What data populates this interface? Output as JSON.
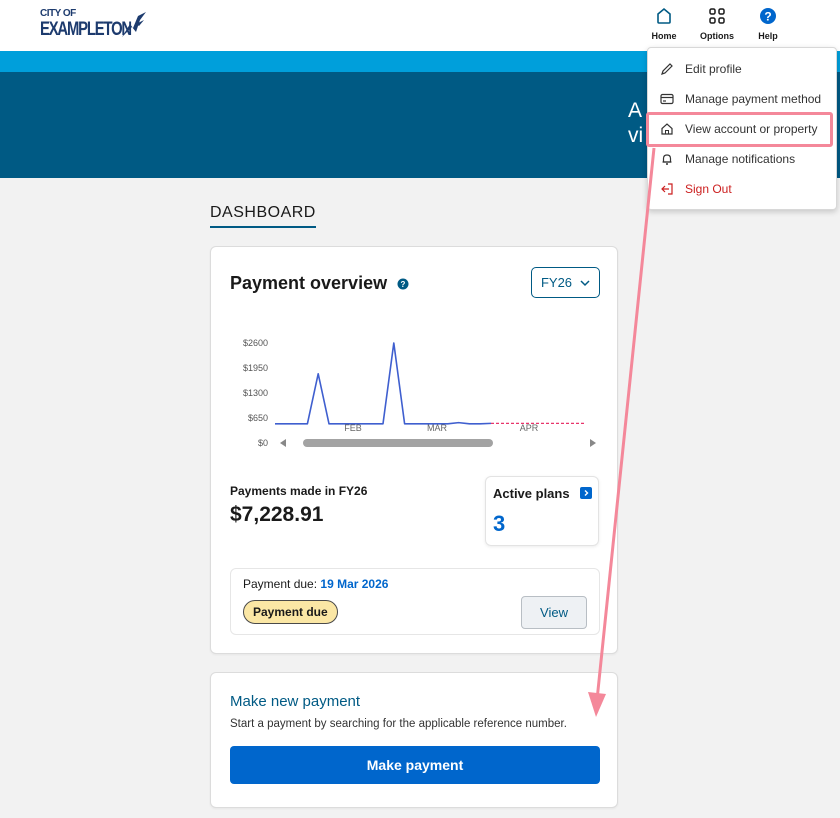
{
  "header": {
    "logo": {
      "line1": "CITY OF",
      "line2": "EXAMPLETON"
    },
    "nav": [
      {
        "id": "home",
        "label": "Home",
        "icon": "home-icon"
      },
      {
        "id": "options",
        "label": "Options",
        "icon": "grid-icon"
      },
      {
        "id": "help",
        "label": "Help",
        "icon": "question-icon"
      }
    ]
  },
  "banner": {
    "text_fragment": "A\nvi"
  },
  "dashboard": {
    "title": "DASHBOARD",
    "payment_overview": {
      "title": "Payment overview",
      "fy_select": "FY26",
      "payments_made_label": "Payments made in FY26",
      "payments_made_value": "$7,228.91",
      "active_plans_label": "Active plans",
      "active_plans_count": "3",
      "payment_due_label": "Payment due:",
      "payment_due_date": "19 Mar 2026",
      "badge": "Payment due",
      "view_button": "View"
    },
    "make_new_payment": {
      "title": "Make new payment",
      "subtitle": "Start a payment by searching for the applicable reference number.",
      "button": "Make payment"
    }
  },
  "dropdown": {
    "items": [
      {
        "label": "Edit profile",
        "icon": "pencil-icon"
      },
      {
        "label": "Manage payment method",
        "icon": "card-icon"
      },
      {
        "label": "View account or property",
        "icon": "house-icon"
      },
      {
        "label": "Manage notifications",
        "icon": "bell-icon"
      },
      {
        "label": "Sign Out",
        "icon": "sign-out-icon"
      }
    ]
  },
  "chart_data": {
    "type": "line",
    "y_ticks": [
      "$2600",
      "$1950",
      "$1300",
      "$650",
      "$0"
    ],
    "ylim": [
      0,
      2600
    ],
    "x_ticks": [
      "FEB",
      "MAR",
      "APR"
    ],
    "series": [
      {
        "values": [
          500,
          500,
          500,
          500,
          1800,
          500,
          500,
          500,
          500,
          500,
          500,
          2600,
          500,
          500,
          500,
          500,
          500,
          530,
          500,
          500,
          510
        ]
      },
      {
        "values": [
          510,
          510,
          510,
          510,
          510,
          510,
          510,
          510,
          510
        ]
      }
    ],
    "colors": {
      "actual": "#3f5fcf",
      "projected": "#e8356b"
    }
  }
}
